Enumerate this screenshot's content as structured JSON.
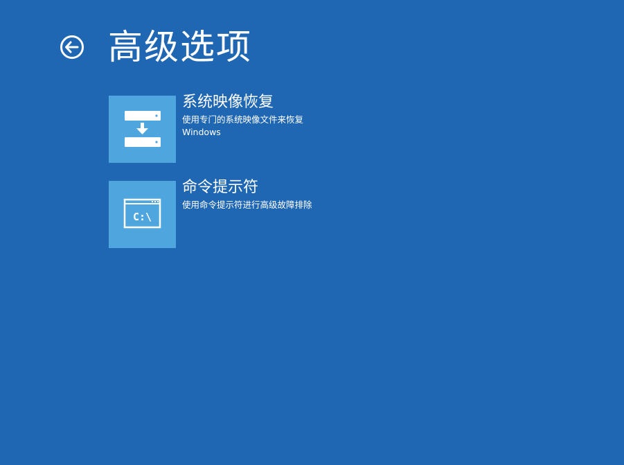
{
  "header": {
    "back_icon": "back-arrow-circle-icon",
    "title": "高级选项"
  },
  "options": [
    {
      "icon": "system-image-restore-icon",
      "title": "系统映像恢复",
      "description": "使用专门的系统映像文件来恢复 Windows"
    },
    {
      "icon": "command-prompt-icon",
      "icon_text": "C:\\",
      "title": "命令提示符",
      "description": "使用命令提示符进行高级故障排除"
    }
  ],
  "colors": {
    "background": "#2067b3",
    "tile": "#4fa6de",
    "text": "#ffffff"
  }
}
